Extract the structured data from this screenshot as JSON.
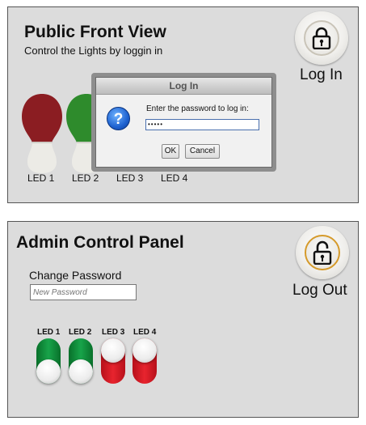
{
  "front": {
    "title": "Public Front View",
    "subtitle": "Control the Lights by loggin in",
    "login_label": "Log In",
    "led_labels": [
      "LED 1",
      "LED 2",
      "LED 3",
      "LED 4"
    ],
    "bulbs": [
      {
        "name": "LED 1",
        "color": "#8b1d22"
      },
      {
        "name": "LED 2",
        "color": "#2e8b2c"
      }
    ]
  },
  "dialog": {
    "title": "Log In",
    "message": "Enter the password to log in:",
    "password_value": "•••••",
    "ok_label": "OK",
    "cancel_label": "Cancel",
    "icon": "question-icon"
  },
  "admin": {
    "title": "Admin Control Panel",
    "change_password_label": "Change Password",
    "new_password_placeholder": "New Password",
    "logout_label": "Log Out",
    "toggles": [
      {
        "label": "LED 1",
        "state": "on"
      },
      {
        "label": "LED 2",
        "state": "on"
      },
      {
        "label": "LED 3",
        "state": "off"
      },
      {
        "label": "LED 4",
        "state": "off"
      }
    ]
  },
  "colors": {
    "toggle_on": "#18a44a",
    "toggle_off": "#e8242e",
    "panel_bg": "#dcdcdc"
  }
}
